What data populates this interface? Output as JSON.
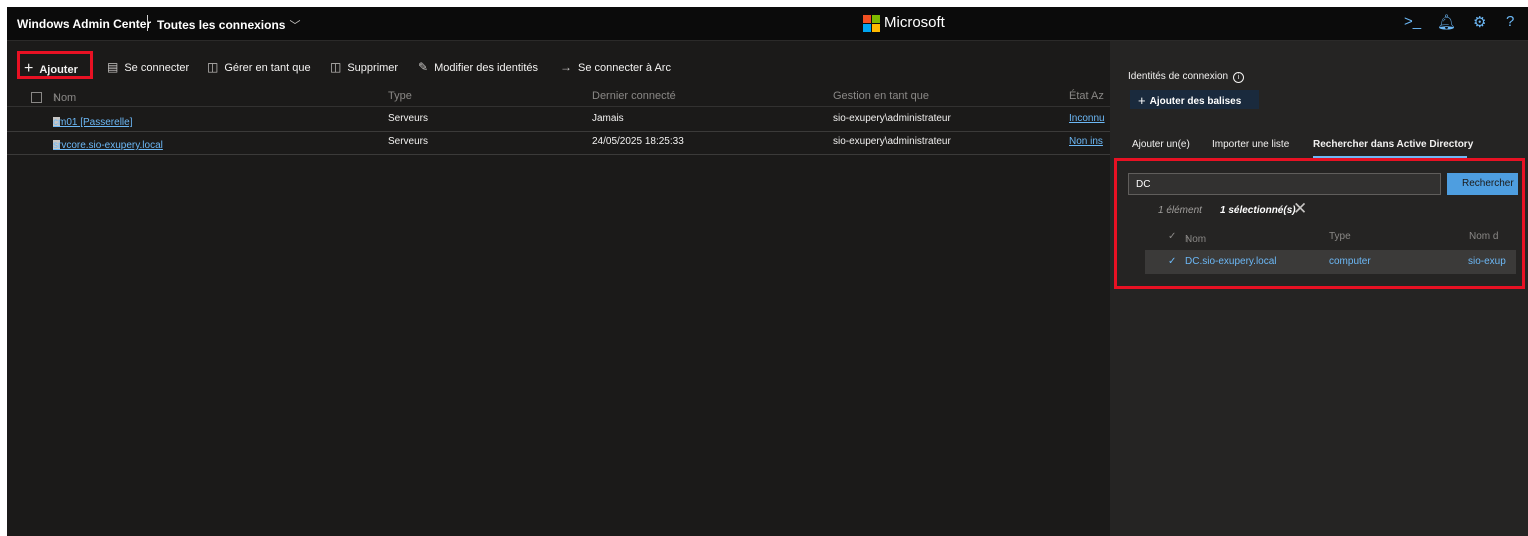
{
  "header": {
    "app_title": "Windows Admin Center",
    "connections_selector": "Toutes les connexions",
    "brand": "Microsoft",
    "icons": [
      "powershell-icon",
      "notifications-icon",
      "settings-icon",
      "help-icon"
    ],
    "help_label": "?"
  },
  "toolbar": {
    "add": "Ajouter",
    "connect": "Se connecter",
    "manage_as": "Gérer en tant que",
    "delete": "Supprimer",
    "edit_identities": "Modifier des identités",
    "connect_arc": "Se connecter à Arc"
  },
  "table": {
    "columns": [
      "Nom",
      "Type",
      "Dernier connecté",
      "Gestion en tant que",
      "État Az"
    ],
    "rows": [
      {
        "name": "cm01 [Passerelle]",
        "type": "Serveurs",
        "last": "Jamais",
        "manage": "sio-exupery\\administrateur",
        "state": "Inconnu"
      },
      {
        "name": "srvcore.sio-exupery.local",
        "type": "Serveurs",
        "last": "24/05/2025 18:25:33",
        "manage": "sio-exupery\\administrateur",
        "state": "Non ins"
      }
    ]
  },
  "panel": {
    "identities_title": "Identités de connexion",
    "add_tags": "Ajouter des balises",
    "tabs": [
      "Ajouter un(e)",
      "Importer une liste",
      "Rechercher dans Active Directory"
    ],
    "active_tab": "Rechercher dans Active Directory",
    "search_value": "DC",
    "search_button": "Rechercher",
    "count_text": "1 élément",
    "selected_text": "1 sélectionné(s)",
    "result_columns": [
      "Nom",
      "Type",
      "Nom d"
    ],
    "result_rows": [
      {
        "name": "DC.sio-exupery.local",
        "type": "computer",
        "domain": "sio-exup"
      }
    ]
  },
  "colors": {
    "accent": "#6cb8f6",
    "highlight": "#e81123",
    "background": "#1b1a19",
    "panel": "#252423"
  }
}
